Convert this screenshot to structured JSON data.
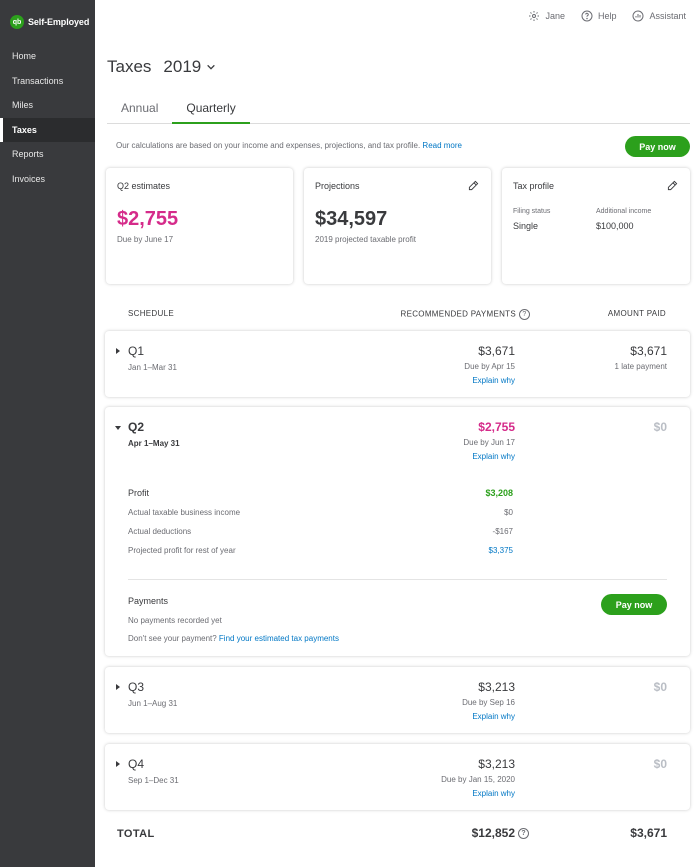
{
  "sidebar": {
    "brand_logo": "qb",
    "brand_name": "Self-Employed",
    "items": [
      {
        "label": "Home"
      },
      {
        "label": "Transactions"
      },
      {
        "label": "Miles"
      },
      {
        "label": "Taxes"
      },
      {
        "label": "Reports"
      },
      {
        "label": "Invoices"
      }
    ],
    "active": "Taxes"
  },
  "topbar": {
    "user": "Jane",
    "help": "Help",
    "assistant": "Assistant"
  },
  "page": {
    "title": "Taxes",
    "year": "2019"
  },
  "tabs": [
    {
      "label": "Annual"
    },
    {
      "label": "Quarterly"
    }
  ],
  "active_tab": "Quarterly",
  "info": {
    "text": "Our calculations are based on your income and expenses, projections, and tax profile.",
    "link": "Read more"
  },
  "pay_now_label": "Pay now",
  "cards": {
    "estimates": {
      "title": "Q2 estimates",
      "amount": "$2,755",
      "sub": "Due by June 17"
    },
    "projections": {
      "title": "Projections",
      "amount": "$34,597",
      "sub": "2019 projected taxable profit"
    },
    "tax_profile": {
      "title": "Tax profile",
      "filing_label": "Filing status",
      "filing_value": "Single",
      "income_label": "Additional income",
      "income_value": "$100,000"
    }
  },
  "schedule_header": {
    "schedule": "SCHEDULE",
    "recommended": "RECOMMENDED PAYMENTS",
    "paid": "AMOUNT PAID",
    "help_glyph": "?"
  },
  "quarters": [
    {
      "name": "Q1",
      "range": "Jan 1–Mar 31",
      "amount": "$3,671",
      "due": "Due by Apr 15",
      "explain": "Explain why",
      "paid": "$3,671",
      "paid_sub": "1 late payment"
    },
    {
      "name": "Q2",
      "range": "Apr 1–May 31",
      "amount": "$2,755",
      "due": "Due by Jun 17",
      "explain": "Explain why",
      "paid": "$0",
      "profit_label": "Profit",
      "profit_value": "$3,208",
      "income_label": "Actual taxable business income",
      "income_value": "$0",
      "deductions_label": "Actual deductions",
      "deductions_value": "-$167",
      "projected_label": "Projected profit for rest of year",
      "projected_value": "$3,375",
      "payments_label": "Payments",
      "no_payments": "No payments recorded yet",
      "dont_see": "Don't see your payment?",
      "find_link": "Find your estimated tax payments"
    },
    {
      "name": "Q3",
      "range": "Jun 1–Aug 31",
      "amount": "$3,213",
      "due": "Due by Sep 16",
      "explain": "Explain why",
      "paid": "$0"
    },
    {
      "name": "Q4",
      "range": "Sep 1–Dec 31",
      "amount": "$3,213",
      "due": "Due by Jan 15, 2020",
      "explain": "Explain why",
      "paid": "$0"
    }
  ],
  "total": {
    "label": "TOTAL",
    "amount": "$12,852",
    "paid": "$3,671"
  },
  "colors": {
    "brand_green": "#2ca01c",
    "accent_pink": "#d52b8a",
    "link_blue": "#0077c5",
    "sidebar_bg": "#393a3d"
  }
}
